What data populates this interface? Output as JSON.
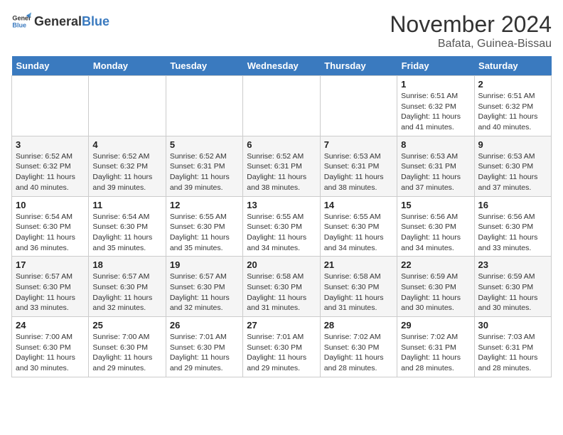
{
  "logo": {
    "general": "General",
    "blue": "Blue"
  },
  "title": "November 2024",
  "location": "Bafata, Guinea-Bissau",
  "weekdays": [
    "Sunday",
    "Monday",
    "Tuesday",
    "Wednesday",
    "Thursday",
    "Friday",
    "Saturday"
  ],
  "weeks": [
    [
      {
        "day": "",
        "info": ""
      },
      {
        "day": "",
        "info": ""
      },
      {
        "day": "",
        "info": ""
      },
      {
        "day": "",
        "info": ""
      },
      {
        "day": "",
        "info": ""
      },
      {
        "day": "1",
        "info": "Sunrise: 6:51 AM\nSunset: 6:32 PM\nDaylight: 11 hours and 41 minutes."
      },
      {
        "day": "2",
        "info": "Sunrise: 6:51 AM\nSunset: 6:32 PM\nDaylight: 11 hours and 40 minutes."
      }
    ],
    [
      {
        "day": "3",
        "info": "Sunrise: 6:52 AM\nSunset: 6:32 PM\nDaylight: 11 hours and 40 minutes."
      },
      {
        "day": "4",
        "info": "Sunrise: 6:52 AM\nSunset: 6:32 PM\nDaylight: 11 hours and 39 minutes."
      },
      {
        "day": "5",
        "info": "Sunrise: 6:52 AM\nSunset: 6:31 PM\nDaylight: 11 hours and 39 minutes."
      },
      {
        "day": "6",
        "info": "Sunrise: 6:52 AM\nSunset: 6:31 PM\nDaylight: 11 hours and 38 minutes."
      },
      {
        "day": "7",
        "info": "Sunrise: 6:53 AM\nSunset: 6:31 PM\nDaylight: 11 hours and 38 minutes."
      },
      {
        "day": "8",
        "info": "Sunrise: 6:53 AM\nSunset: 6:31 PM\nDaylight: 11 hours and 37 minutes."
      },
      {
        "day": "9",
        "info": "Sunrise: 6:53 AM\nSunset: 6:30 PM\nDaylight: 11 hours and 37 minutes."
      }
    ],
    [
      {
        "day": "10",
        "info": "Sunrise: 6:54 AM\nSunset: 6:30 PM\nDaylight: 11 hours and 36 minutes."
      },
      {
        "day": "11",
        "info": "Sunrise: 6:54 AM\nSunset: 6:30 PM\nDaylight: 11 hours and 35 minutes."
      },
      {
        "day": "12",
        "info": "Sunrise: 6:55 AM\nSunset: 6:30 PM\nDaylight: 11 hours and 35 minutes."
      },
      {
        "day": "13",
        "info": "Sunrise: 6:55 AM\nSunset: 6:30 PM\nDaylight: 11 hours and 34 minutes."
      },
      {
        "day": "14",
        "info": "Sunrise: 6:55 AM\nSunset: 6:30 PM\nDaylight: 11 hours and 34 minutes."
      },
      {
        "day": "15",
        "info": "Sunrise: 6:56 AM\nSunset: 6:30 PM\nDaylight: 11 hours and 34 minutes."
      },
      {
        "day": "16",
        "info": "Sunrise: 6:56 AM\nSunset: 6:30 PM\nDaylight: 11 hours and 33 minutes."
      }
    ],
    [
      {
        "day": "17",
        "info": "Sunrise: 6:57 AM\nSunset: 6:30 PM\nDaylight: 11 hours and 33 minutes."
      },
      {
        "day": "18",
        "info": "Sunrise: 6:57 AM\nSunset: 6:30 PM\nDaylight: 11 hours and 32 minutes."
      },
      {
        "day": "19",
        "info": "Sunrise: 6:57 AM\nSunset: 6:30 PM\nDaylight: 11 hours and 32 minutes."
      },
      {
        "day": "20",
        "info": "Sunrise: 6:58 AM\nSunset: 6:30 PM\nDaylight: 11 hours and 31 minutes."
      },
      {
        "day": "21",
        "info": "Sunrise: 6:58 AM\nSunset: 6:30 PM\nDaylight: 11 hours and 31 minutes."
      },
      {
        "day": "22",
        "info": "Sunrise: 6:59 AM\nSunset: 6:30 PM\nDaylight: 11 hours and 30 minutes."
      },
      {
        "day": "23",
        "info": "Sunrise: 6:59 AM\nSunset: 6:30 PM\nDaylight: 11 hours and 30 minutes."
      }
    ],
    [
      {
        "day": "24",
        "info": "Sunrise: 7:00 AM\nSunset: 6:30 PM\nDaylight: 11 hours and 30 minutes."
      },
      {
        "day": "25",
        "info": "Sunrise: 7:00 AM\nSunset: 6:30 PM\nDaylight: 11 hours and 29 minutes."
      },
      {
        "day": "26",
        "info": "Sunrise: 7:01 AM\nSunset: 6:30 PM\nDaylight: 11 hours and 29 minutes."
      },
      {
        "day": "27",
        "info": "Sunrise: 7:01 AM\nSunset: 6:30 PM\nDaylight: 11 hours and 29 minutes."
      },
      {
        "day": "28",
        "info": "Sunrise: 7:02 AM\nSunset: 6:30 PM\nDaylight: 11 hours and 28 minutes."
      },
      {
        "day": "29",
        "info": "Sunrise: 7:02 AM\nSunset: 6:31 PM\nDaylight: 11 hours and 28 minutes."
      },
      {
        "day": "30",
        "info": "Sunrise: 7:03 AM\nSunset: 6:31 PM\nDaylight: 11 hours and 28 minutes."
      }
    ]
  ]
}
